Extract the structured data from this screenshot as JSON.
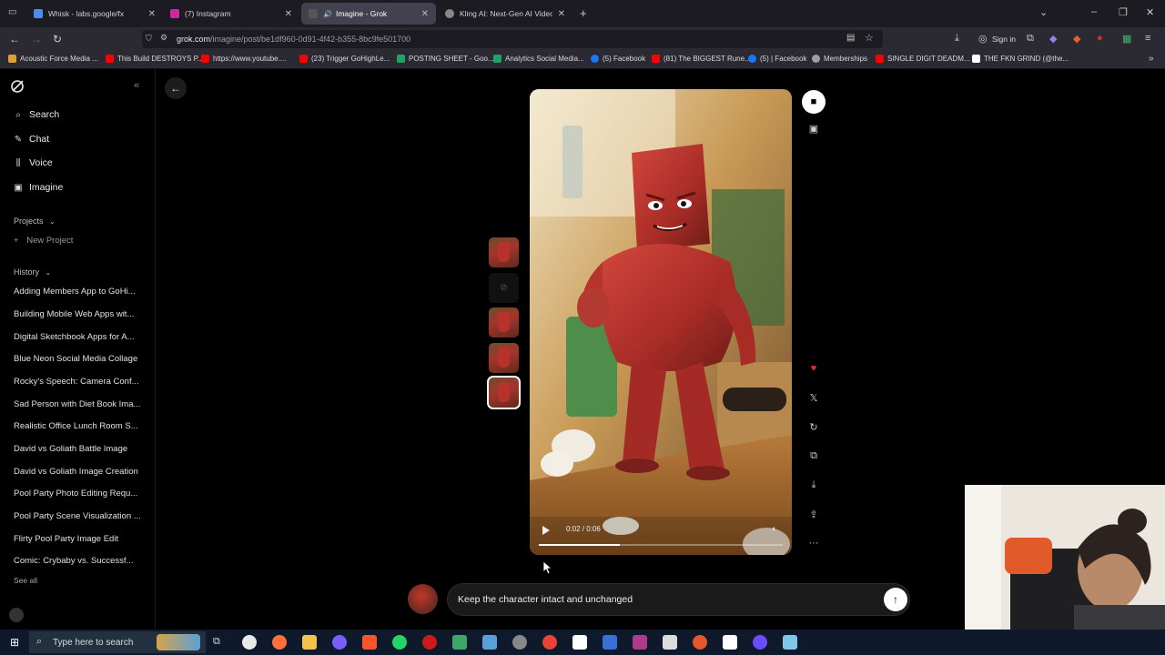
{
  "browser": {
    "tabs": [
      {
        "label": "Whisk - labs.google/fx",
        "color": "#4c8bf5"
      },
      {
        "label": "(7) Instagram",
        "color": "#d6249f"
      },
      {
        "label": "Imagine - Grok",
        "color": "#222222",
        "audio": "🔊"
      },
      {
        "label": "Kling AI: Next-Gen AI Video & AI",
        "color": "#888888"
      }
    ],
    "url_host": "grok.com",
    "url_path": "/imagine/post/be1df960-0d91-4f42-b355-8bc9fe501700",
    "sign_in": "Sign in",
    "bookmarks": [
      {
        "label": "Acoustic Force Media ...",
        "color": "#e0a030"
      },
      {
        "label": "This Build DESTROYS P...",
        "color": "#ff0000"
      },
      {
        "label": "https://www.youtube....",
        "color": "#ff0000"
      },
      {
        "label": "(23) Trigger GoHighLe...",
        "color": "#ff0000"
      },
      {
        "label": "POSTING SHEET - Goo...",
        "color": "#1fa463"
      },
      {
        "label": "Analytics Social Media...",
        "color": "#1fa463"
      },
      {
        "label": "(5) Facebook",
        "color": "#1877f2"
      },
      {
        "label": "(81) The BIGGEST Rune...",
        "color": "#ff0000"
      },
      {
        "label": "(5) | Facebook",
        "color": "#1877f2"
      },
      {
        "label": "Memberships",
        "color": "#9aa0a6"
      },
      {
        "label": "SINGLE DIGIT DEADM...",
        "color": "#ff0000"
      },
      {
        "label": "THE FKN GRIND (@the...",
        "color": "#ffffff"
      }
    ]
  },
  "sidebar": {
    "nav": [
      {
        "label": "Search",
        "icon": "search-icon",
        "glyph": "⌕"
      },
      {
        "label": "Chat",
        "icon": "chat-icon",
        "glyph": "✎"
      },
      {
        "label": "Voice",
        "icon": "voice-icon",
        "glyph": "⫼"
      },
      {
        "label": "Imagine",
        "icon": "image-icon",
        "glyph": "▣"
      }
    ],
    "projects_label": "Projects",
    "new_project": "New Project",
    "history_label": "History",
    "history": [
      "Adding Members App to GoHi...",
      "Building Mobile Web Apps wit...",
      "Digital Sketchbook Apps for A...",
      "Blue Neon Social Media Collage",
      "Rocky's Speech: Camera Conf...",
      "Sad Person with Diet Book Ima...",
      "Realistic Office Lunch Room S...",
      "David vs Goliath Battle Image",
      "David vs Goliath Image Creation",
      "Pool Party Photo Editing Requ...",
      "Pool Party Scene Visualization ...",
      "Flirty Pool Party Image Edit",
      "Comic: Crybaby vs. Successf..."
    ],
    "see_all": "See all"
  },
  "viewer": {
    "video_time": "0:02 / 0:06"
  },
  "prompt": {
    "value": "Keep the character intact and unchanged"
  },
  "taskbar": {
    "search_placeholder": "Type here to search"
  }
}
